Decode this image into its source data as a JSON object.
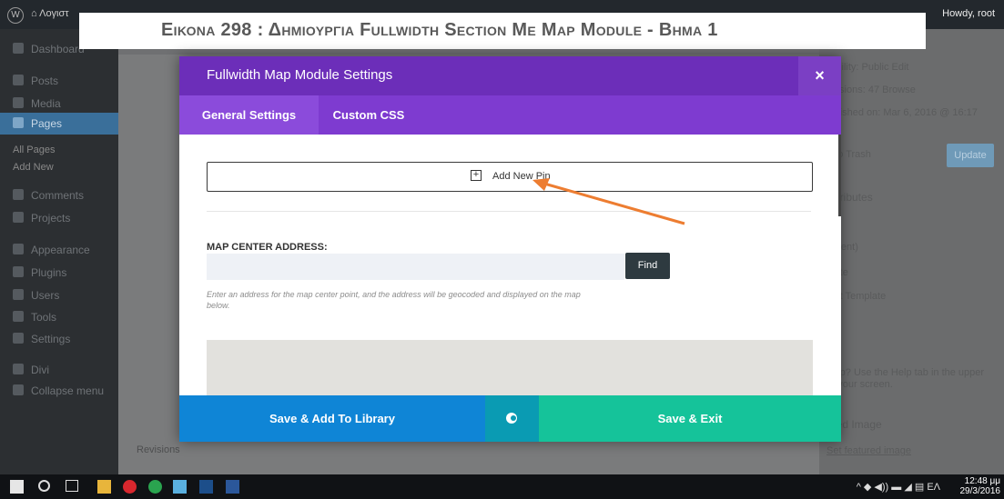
{
  "caption": "Εικονα 298 : Δημιουργια Fullwidth Section Με Map Module - Βημα 1",
  "adminbar": {
    "site": "Λογιστ",
    "user": "Howdy, root"
  },
  "sidebar": {
    "items": [
      {
        "label": "Dashboard",
        "icon": "dashboard-icon"
      },
      {
        "label": "Posts",
        "icon": "pin-icon"
      },
      {
        "label": "Media",
        "icon": "media-icon"
      },
      {
        "label": "Pages",
        "icon": "pages-icon"
      },
      {
        "label": "Comments",
        "icon": "comment-icon"
      },
      {
        "label": "Projects",
        "icon": "projects-icon"
      },
      {
        "label": "Appearance",
        "icon": "brush-icon"
      },
      {
        "label": "Plugins",
        "icon": "plugin-icon"
      },
      {
        "label": "Users",
        "icon": "users-icon"
      },
      {
        "label": "Tools",
        "icon": "tools-icon"
      },
      {
        "label": "Settings",
        "icon": "settings-icon"
      },
      {
        "label": "Divi",
        "icon": "divi-icon"
      },
      {
        "label": "Collapse menu",
        "icon": "collapse-icon"
      }
    ],
    "sub_all_pages": "All Pages",
    "sub_add_new": "Add New"
  },
  "rightcol": {
    "visibility": "isibility: Public Edit",
    "revisions": "evisions: 47 Browse",
    "published": "ublished on: Mar 6, 2016 @ 16:17",
    "trash": "e to Trash",
    "update": "Update",
    "attributes": "Attributes",
    "parent": "parent)",
    "template": "plate",
    "default_template": "ault Template",
    "help": "help? Use the Help tab in the upper",
    "help2": "of your screen.",
    "featured": "ured Image",
    "set_featured": "Set featured image"
  },
  "revisions_label": "Revisions",
  "modal": {
    "title": "Fullwidth Map Module Settings",
    "close_symbol": "×",
    "tabs": [
      "General Settings",
      "Custom CSS"
    ],
    "add_pin": "Add New Pin",
    "address_label": "MAP CENTER ADDRESS:",
    "address_value": "",
    "find_button": "Find",
    "address_desc": "Enter an address for the map center point, and the address will be geocoded and displayed on the map below.",
    "save_library": "Save & Add To Library",
    "save_exit": "Save & Exit"
  },
  "taskbar": {
    "time": "12:48 μμ",
    "date": "29/3/2016",
    "lang": "ΕΛ"
  },
  "colors": {
    "modal_header": "#6c2eb9",
    "tabs": "#7e3bd0",
    "save_library": "#0f85d6",
    "save_exit": "#15c39a",
    "arrow": "#ed7d31"
  }
}
